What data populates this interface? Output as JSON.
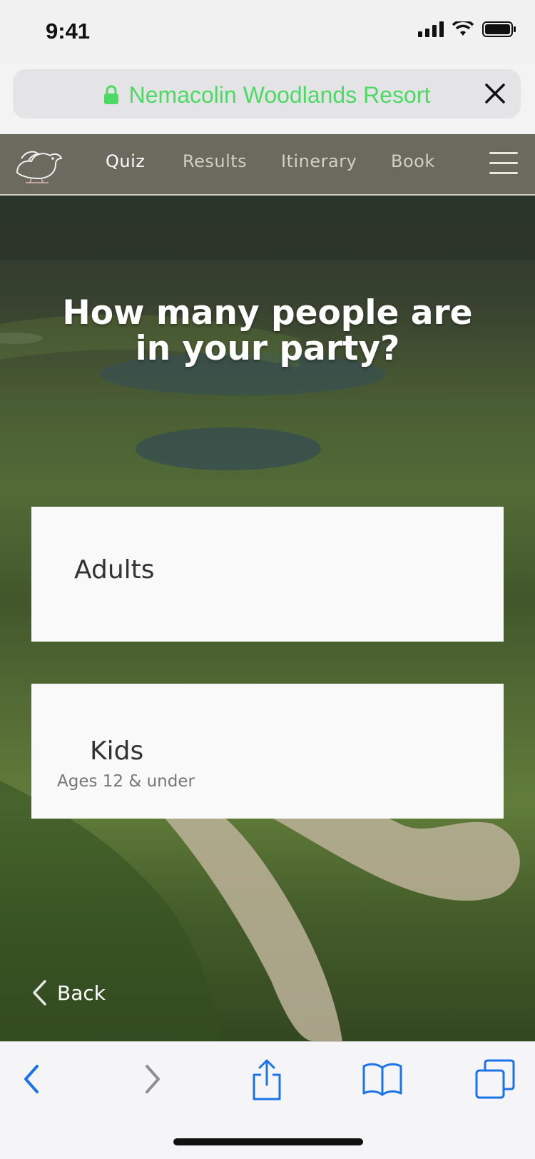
{
  "status_bar": {
    "time": "9:41"
  },
  "browser": {
    "url_title": "Nemacolin Woodlands Resort",
    "colors": {
      "url_text": "#4cd964",
      "toolbar_icon": "#1a73e8"
    }
  },
  "nav": {
    "tabs": [
      {
        "label": "Quiz",
        "active": true
      },
      {
        "label": "Results",
        "active": false
      },
      {
        "label": "Itinerary",
        "active": false
      },
      {
        "label": "Book",
        "active": false
      }
    ],
    "colors": {
      "bar": "#6b6a5f"
    }
  },
  "quiz": {
    "question": "How many people are\nin your party?",
    "options": [
      {
        "label": "Adults",
        "sublabel": ""
      },
      {
        "label": "Kids",
        "sublabel": "Ages 12 & under"
      }
    ],
    "back_label": "Back"
  },
  "icons": [
    "lock-icon",
    "close-icon",
    "bird-logo",
    "hamburger-icon",
    "chevron-left-icon",
    "back-icon",
    "forward-icon",
    "share-icon",
    "bookmarks-icon",
    "tabs-icon",
    "signal-icon",
    "wifi-icon",
    "battery-icon"
  ]
}
